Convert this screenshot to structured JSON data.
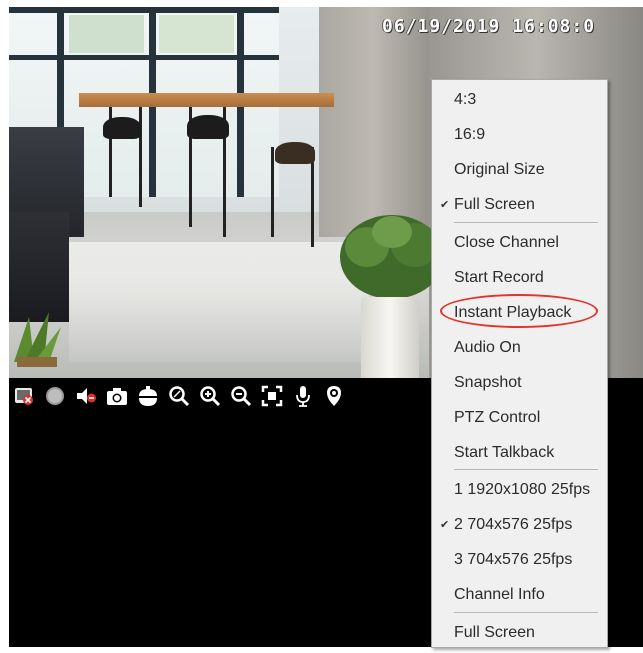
{
  "overlay": {
    "timestamp": "06/19/2019  16:08:0"
  },
  "toolbar": {
    "icons": [
      "close-preview-icon",
      "record-icon",
      "audio-mute-icon",
      "snapshot-camera-icon",
      "ptz-camera-icon",
      "zoom-fit-icon",
      "zoom-in-icon",
      "zoom-out-icon",
      "fullscreen-icon",
      "microphone-icon",
      "settings-icon"
    ]
  },
  "context_menu": {
    "items": [
      {
        "label": "4:3",
        "checked": false
      },
      {
        "label": "16:9",
        "checked": false
      },
      {
        "label": "Original Size",
        "checked": false
      },
      {
        "label": "Full Screen",
        "checked": true
      },
      {
        "label": "Close Channel",
        "checked": false
      },
      {
        "label": "Start Record",
        "checked": false
      },
      {
        "label": "Instant Playback",
        "checked": false,
        "highlighted": true
      },
      {
        "label": "Audio On",
        "checked": false
      },
      {
        "label": "Snapshot",
        "checked": false
      },
      {
        "label": "PTZ Control",
        "checked": false
      },
      {
        "label": "Start Talkback",
        "checked": false
      },
      {
        "label": "1 1920x1080 25fps",
        "checked": false
      },
      {
        "label": "2 704x576 25fps",
        "checked": true
      },
      {
        "label": "3 704x576 25fps",
        "checked": false
      },
      {
        "label": "Channel Info",
        "checked": false
      },
      {
        "label": "Full Screen",
        "checked": false
      }
    ],
    "check_mark": "✔"
  },
  "colors": {
    "highlight_oval": "#e2342a",
    "menu_background": "#f0f0f0",
    "viewer_background": "#000000"
  }
}
